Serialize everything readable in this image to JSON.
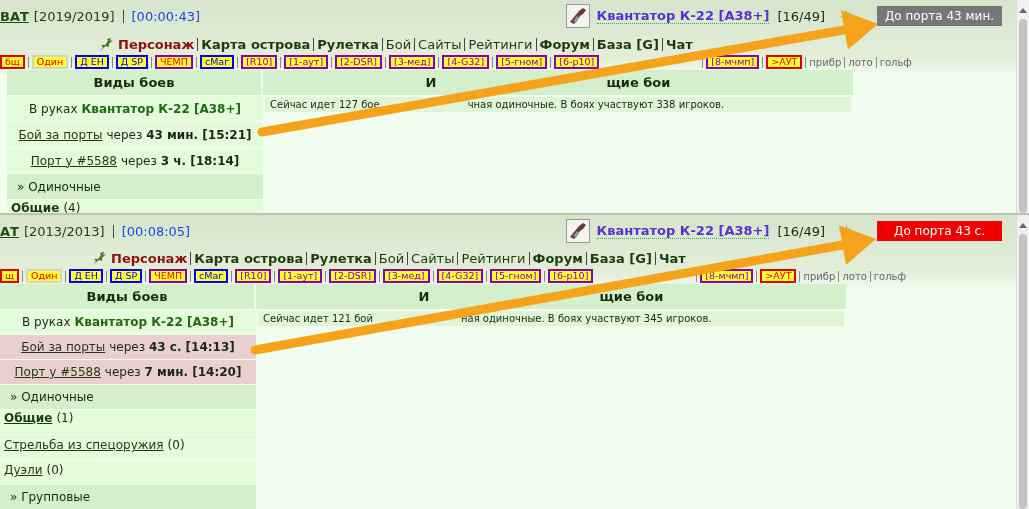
{
  "panels": [
    {
      "header": {
        "name": "ВАТ",
        "rating": "[2019/2019]",
        "timer": "[00:00:43]",
        "weapon": "Квантатор К-22 [А38+]",
        "ammo": "[16/49]",
        "port_badge": {
          "text": "До порта 43 мин.",
          "alert": false
        }
      },
      "nav": [
        {
          "label": "Персонаж",
          "kind": "primary"
        },
        {
          "label": "Карта острова",
          "kind": "bold"
        },
        {
          "label": "Рулетка",
          "kind": "bold"
        },
        {
          "label": "Бой",
          "kind": "plain"
        },
        {
          "label": "Сайты",
          "kind": "plain"
        },
        {
          "label": "Рейтинги",
          "kind": "plain"
        },
        {
          "label": "Форум",
          "kind": "bold"
        },
        {
          "label": "База [G]",
          "kind": "bold"
        },
        {
          "label": "Чат",
          "kind": "bold"
        }
      ],
      "tags": [
        {
          "label": "бщ",
          "kind": "hot",
          "color": "#dd0000"
        },
        {
          "label": "Один",
          "kind": "hot",
          "color": "#d4d4c8"
        },
        {
          "label": "Д ЕН",
          "kind": "duel",
          "color": "#0000ee"
        },
        {
          "label": "Д SP",
          "kind": "duel",
          "color": "#0000ee"
        },
        {
          "label": "ЧЕМП",
          "kind": "hot",
          "color": "#8800aa"
        },
        {
          "label": "сМаг",
          "kind": "duel",
          "color": "#0000ee"
        },
        {
          "label": "[R10]",
          "kind": "tour",
          "color": "#8800aa"
        },
        {
          "label": "[1-аут]",
          "kind": "tour",
          "color": "#8800aa"
        },
        {
          "label": "[2-DSR]",
          "kind": "tour",
          "color": "#8800aa"
        },
        {
          "label": "[3-мед]",
          "kind": "tour",
          "color": "#8800aa"
        },
        {
          "label": "[4-G32]",
          "kind": "tour",
          "color": "#8800aa"
        },
        {
          "label": "[5-гном]",
          "kind": "tour",
          "color": "#8800aa"
        },
        {
          "label": "[6-р10]",
          "kind": "tour",
          "color": "#8800aa"
        },
        {
          "label": "[8-мчмп]",
          "kind": "tour",
          "color": "#8800aa"
        },
        {
          "label": ">АУТ",
          "kind": "hot",
          "color": "#dd0000"
        }
      ],
      "extras": [
        "прибр",
        "лото",
        "гольф"
      ],
      "left_heading": "Виды боев",
      "right_heading": [
        "И",
        "щие бои"
      ],
      "info": [
        "Сейчас идет 127 бое",
        "чная одиночные. В боях участвуют 338 игроков."
      ],
      "rows": [
        {
          "kind": "weapon",
          "text": "В руках **Квантатор К-22 [А38+]**"
        },
        {
          "kind": "timer",
          "link": "Бой за порты",
          "text": "через **43 мин. [15:21]**",
          "alert": false
        },
        {
          "kind": "timer",
          "link": "Порт у #5588",
          "text": "через **3 ч. [18:14]**",
          "alert": false
        },
        {
          "kind": "section",
          "text": "» Одиночные"
        },
        {
          "kind": "category",
          "link": "Общие",
          "count": "(4)",
          "bold": true
        }
      ]
    },
    {
      "header": {
        "name": "АТ",
        "rating": "[2013/2013]",
        "timer": "[00:08:05]",
        "weapon": "Квантатор К-22 [А38+]",
        "ammo": "[16/49]",
        "port_badge": {
          "text": "До порта 43 с.",
          "alert": true
        }
      },
      "nav": [
        {
          "label": "Персонаж",
          "kind": "primary"
        },
        {
          "label": "Карта острова",
          "kind": "bold"
        },
        {
          "label": "Рулетка",
          "kind": "bold"
        },
        {
          "label": "Бой",
          "kind": "plain"
        },
        {
          "label": "Сайты",
          "kind": "plain"
        },
        {
          "label": "Рейтинги",
          "kind": "plain"
        },
        {
          "label": "Форум",
          "kind": "bold"
        },
        {
          "label": "База [G]",
          "kind": "bold"
        },
        {
          "label": "Чат",
          "kind": "bold"
        }
      ],
      "tags": [
        {
          "label": "щ",
          "kind": "hot",
          "color": "#dd0000"
        },
        {
          "label": "Один",
          "kind": "hot",
          "color": "#d4d4c8"
        },
        {
          "label": "Д ЕН",
          "kind": "duel",
          "color": "#0000ee"
        },
        {
          "label": "Д SP",
          "kind": "duel",
          "color": "#0000ee"
        },
        {
          "label": "ЧЕМП",
          "kind": "hot",
          "color": "#8800aa"
        },
        {
          "label": "сМаг",
          "kind": "duel",
          "color": "#0000ee"
        },
        {
          "label": "[R10]",
          "kind": "tour",
          "color": "#8800aa"
        },
        {
          "label": "[1-аут]",
          "kind": "tour",
          "color": "#8800aa"
        },
        {
          "label": "[2-DSR]",
          "kind": "tour",
          "color": "#8800aa"
        },
        {
          "label": "[3-мед]",
          "kind": "tour",
          "color": "#8800aa"
        },
        {
          "label": "[4-G32]",
          "kind": "tour",
          "color": "#8800aa"
        },
        {
          "label": "[5-гном]",
          "kind": "tour",
          "color": "#8800aa"
        },
        {
          "label": "[6-р10]",
          "kind": "tour",
          "color": "#8800aa"
        },
        {
          "label": "[8-мчмп]",
          "kind": "tour",
          "color": "#8800aa"
        },
        {
          "label": ">АУТ",
          "kind": "hot",
          "color": "#dd0000"
        }
      ],
      "extras": [
        "прибр",
        "лото",
        "гольф"
      ],
      "left_heading": "Виды боев",
      "right_heading": [
        "И",
        "щие бои"
      ],
      "info": [
        "Сейчас идет 121 бой",
        "ная одиночные. В боях участвуют 345 игроков."
      ],
      "rows": [
        {
          "kind": "weapon",
          "text": "В руках **Квантатор К-22 [А38+]**"
        },
        {
          "kind": "timer",
          "link": "Бой за порты",
          "text": "через **43 с. [14:13]**",
          "alert": true
        },
        {
          "kind": "timer",
          "link": "Порт у #5588",
          "text": "через **7 мин. [14:20]**",
          "alert": true
        },
        {
          "kind": "section",
          "text": "» Одиночные"
        },
        {
          "kind": "category",
          "link": "Общие",
          "count": "(1)",
          "bold": true
        },
        {
          "kind": "category",
          "link": "Стрельба из спецоружия",
          "count": "(0)",
          "bold": false
        },
        {
          "kind": "category",
          "link": "Дуэли",
          "count": "(0)",
          "bold": false
        },
        {
          "kind": "section",
          "text": "» Групповые"
        }
      ]
    }
  ]
}
